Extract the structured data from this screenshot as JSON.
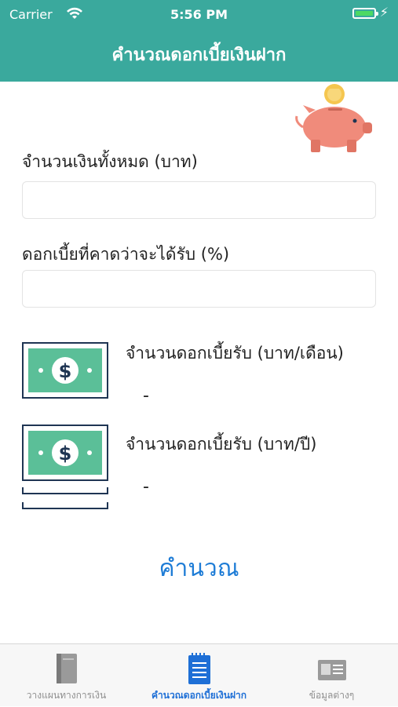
{
  "status_bar": {
    "carrier": "Carrier",
    "time": "5:56 PM",
    "wifi_icon": "wifi-icon",
    "battery_icon": "battery-icon"
  },
  "nav": {
    "title": "คำนวณดอกเบี้ยเงินฝาก"
  },
  "form": {
    "amount_label": "จำนวนเงินทั้งหมด (บาท)",
    "amount_value": "",
    "rate_label": "ดอกเบี้ยที่คาดว่าจะได้รับ (%)",
    "rate_value": ""
  },
  "results": {
    "monthly_label": "จำนวนดอกเบี้ยรับ (บาท/เดือน)",
    "monthly_value": "-",
    "yearly_label": "จำนวนดอกเบี้ยรับ (บาท/ปี)",
    "yearly_value": "-"
  },
  "calculate_label": "คำนวณ",
  "tabs": [
    {
      "label": "วางแผนทางการเงิน",
      "icon": "book-icon",
      "active": false
    },
    {
      "label": "คำนวณดอกเบี้ยเงินฝาก",
      "icon": "notepad-icon",
      "active": true
    },
    {
      "label": "ข้อมูลต่างๆ",
      "icon": "id-card-icon",
      "active": false
    }
  ],
  "colors": {
    "header": "#3aa99d",
    "accent": "#1e7cd6",
    "money_green": "#5bbf98",
    "money_outline": "#1f3553",
    "piggy": "#f08b7b",
    "coin": "#f5c64f"
  }
}
